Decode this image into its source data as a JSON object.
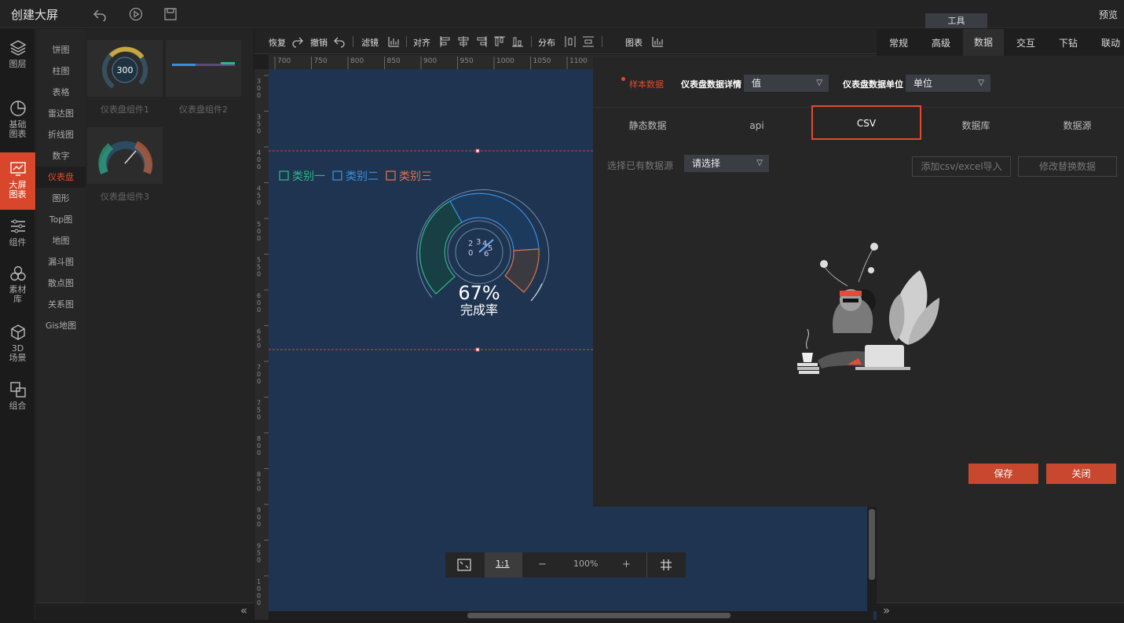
{
  "header": {
    "title": "创建大屏",
    "preview": "预览",
    "tool_tab": "工具"
  },
  "rail": [
    {
      "label": "图层"
    },
    {
      "label": "基础\n图表"
    },
    {
      "label": "大屏\n图表"
    },
    {
      "label": "组件"
    },
    {
      "label": "素材\n库"
    },
    {
      "label": "3D\n场景"
    },
    {
      "label": "组合"
    }
  ],
  "categories": [
    "饼图",
    "柱图",
    "表格",
    "雷达图",
    "折线图",
    "数字",
    "仪表盘",
    "图形",
    "Top图",
    "地图",
    "漏斗图",
    "散点图",
    "关系图",
    "Gis地图"
  ],
  "components": [
    {
      "label": "仪表盘组件1",
      "value": "300"
    },
    {
      "label": "仪表盘组件2"
    },
    {
      "label": "仪表盘组件3"
    }
  ],
  "toolbar": {
    "redo": "恢复",
    "undo": "撤销",
    "filter": "滤镜",
    "align": "对齐",
    "distribute": "分布",
    "chart": "图表"
  },
  "ruler": {
    "h": [
      "700",
      "750",
      "800",
      "850",
      "900",
      "950",
      "1000",
      "1050",
      "1100"
    ],
    "v": [
      "300",
      "350",
      "400",
      "450",
      "500",
      "550",
      "600",
      "650",
      "700",
      "750",
      "800",
      "850",
      "900",
      "950",
      "1000"
    ]
  },
  "gauge": {
    "legend": [
      "类别一",
      "类别二",
      "类别三"
    ],
    "inner": [
      "2",
      "3",
      "4",
      "5",
      "0",
      "6"
    ],
    "percent": "67%",
    "caption": "完成率"
  },
  "zoom": {
    "level": "100%",
    "one_to_one": "1:1",
    "minus": "−",
    "plus": "+"
  },
  "right_tabs": [
    "常规",
    "高级",
    "数据",
    "交互",
    "下钻",
    "联动"
  ],
  "panel": {
    "sample": "样本数据",
    "detail_label": "仪表盘数据详情",
    "detail_value": "值",
    "unit_label": "仪表盘数据单位",
    "unit_value": "单位",
    "tabs": [
      "静态数据",
      "api",
      "CSV",
      "数据库",
      "数据源"
    ],
    "source_label": "选择已有数据源",
    "source_placeholder": "请选择",
    "add_csv": "添加csv/excel导入",
    "replace": "修改替换数据",
    "save": "保存",
    "close": "关闭"
  },
  "colors": {
    "accent": "#d8472b",
    "cat1": "#2fb585",
    "cat2": "#3a8fe0",
    "cat3": "#e0734a",
    "stage": "#1e3450"
  }
}
